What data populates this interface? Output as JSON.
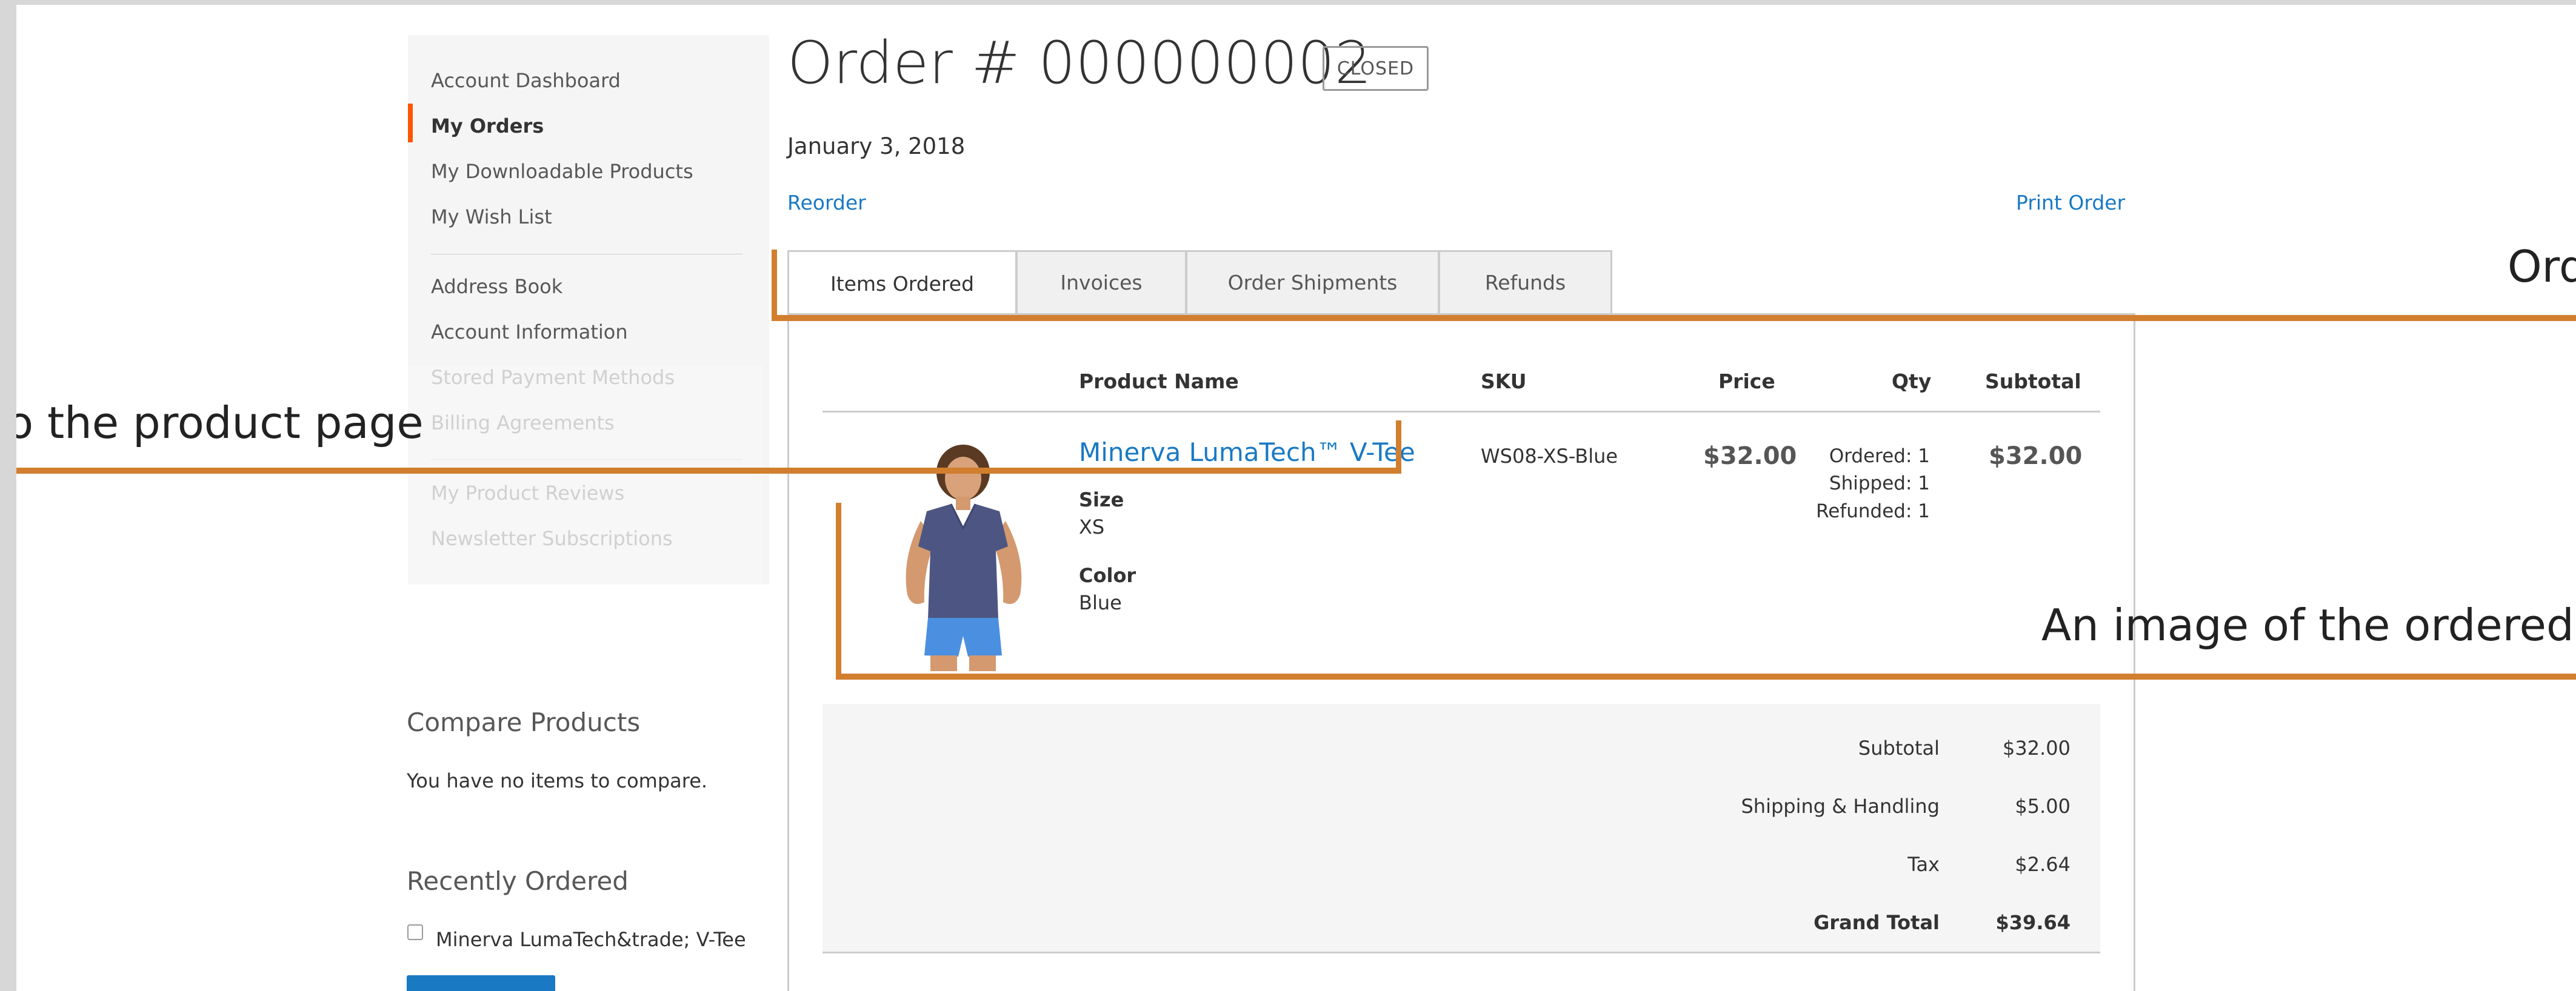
{
  "sidebar": {
    "items": [
      {
        "label": "Account Dashboard"
      },
      {
        "label": "My Orders",
        "active": true
      },
      {
        "label": "My Downloadable Products"
      },
      {
        "label": "My Wish List"
      },
      {
        "label": "Address Book"
      },
      {
        "label": "Account Information"
      },
      {
        "label": "Stored Payment Methods"
      },
      {
        "label": "Billing Agreements"
      },
      {
        "label": "My Product Reviews"
      },
      {
        "label": "Newsletter Subscriptions"
      }
    ]
  },
  "compare": {
    "title": "Compare Products",
    "empty_text": "You have no items to compare."
  },
  "recently_ordered": {
    "title": "Recently Ordered",
    "item_label": "Minerva LumaTech&trade; V-Tee"
  },
  "order": {
    "title": "Order # 000000002",
    "status": "CLOSED",
    "date": "January 3, 2018",
    "reorder_label": "Reorder",
    "print_label": "Print Order"
  },
  "tabs": [
    {
      "label": "Items Ordered",
      "active": true
    },
    {
      "label": "Invoices"
    },
    {
      "label": "Order Shipments"
    },
    {
      "label": "Refunds"
    }
  ],
  "table": {
    "headers": {
      "product_name": "Product Name",
      "sku": "SKU",
      "price": "Price",
      "qty": "Qty",
      "subtotal": "Subtotal"
    },
    "row": {
      "product_name": "Minerva LumaTech™ V-Tee",
      "size_label": "Size",
      "size_value": "XS",
      "color_label": "Color",
      "color_value": "Blue",
      "sku": "WS08-XS-Blue",
      "price": "$32.00",
      "qty_ordered": "Ordered: 1",
      "qty_shipped": "Shipped: 1",
      "qty_refunded": "Refunded: 1",
      "subtotal": "$32.00"
    }
  },
  "totals": {
    "subtotal_label": "Subtotal",
    "subtotal_value": "$32.00",
    "shipping_label": "Shipping & Handling",
    "shipping_value": "$5.00",
    "tax_label": "Tax",
    "tax_value": "$2.64",
    "grand_label": "Grand Total",
    "grand_value": "$39.64"
  },
  "annotations": {
    "left_text": "o the product page",
    "right_top_text": "Ord",
    "right_mid_text": "An image of the ordered p",
    "color": "#d17f2f"
  }
}
